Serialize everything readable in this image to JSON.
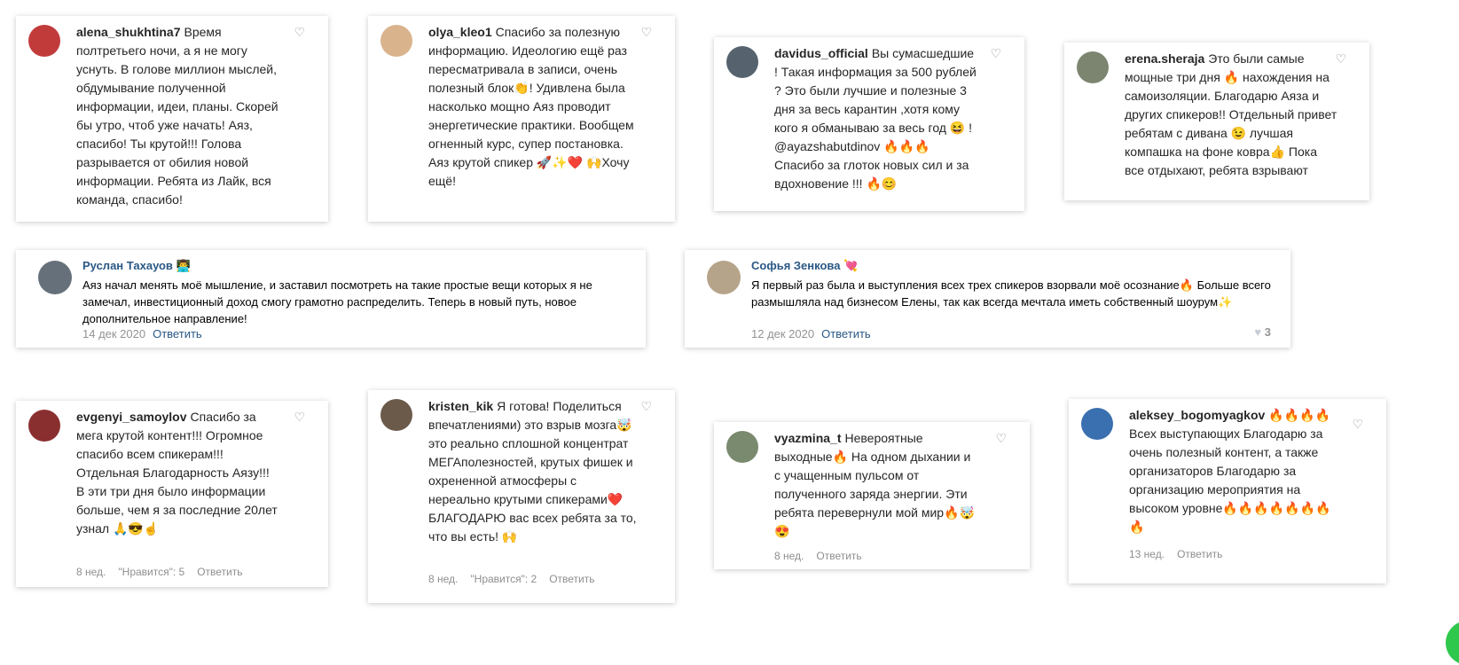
{
  "row1": [
    {
      "username": "alena_shukhtina7",
      "text": "Время полтретьего ночи, а я не могу уснуть. В голове миллион мыслей, обдумывание полученной информации, идеи, планы. Скорей бы утро, чтоб уже начать! Аяз, спасибо! Ты крутой!!! Голова разрывается от обилия новой информации. Ребята из Лайк, вся команда, спасибо!"
    },
    {
      "username": "olya_kleo1",
      "text": "Спасибо за полезную информацию. Идеологию ещё раз пересматривала в записи, очень полезный блок👏! Удивлена была насколько мощно Аяз проводит энергетические практики. Вообщем огненный курс, супер постановка. Аяз крутой спикер 🚀✨❤️ 🙌Хочу ещё!"
    },
    {
      "username": "davidus_official",
      "text": "Вы сумасшедшие ! Такая информация за 500 рублей ? Это были лучшие и полезные 3 дня за весь карантин ,хотя кому кого я обманываю за весь год 😆 ! @ayazshabutdinov 🔥🔥🔥 Спасибо за глоток новых сил и за вдохновение !!! 🔥😊"
    },
    {
      "username": "erena.sheraja",
      "text": "Это были самые мощные три дня 🔥 нахождения на самоизоляции. Благодарю Аяза и других спикеров!! Отдельный привет ребятам с дивана 😉 лучшая компашка на фоне ковра👍 Пока все отдыхают, ребята взрывают"
    }
  ],
  "vk": [
    {
      "name": "Руслан Тахауов 👨‍💻",
      "text": "Аяз начал менять моё мышление, и заставил посмотреть на такие простые вещи которых я не замечал, инвестиционный доход смогу грамотно распределить. Теперь в новый путь, новое дополнительное направление!",
      "date": "14 дек 2020",
      "reply": "Ответить"
    },
    {
      "name": "Софья Зенкова 💘",
      "text": "Я первый раз была и выступления всех трех спикеров взорвали моё осознание🔥 Больше всего размышляла над бизнесом Елены, так как всегда мечтала иметь собственный шоурум✨",
      "date": "12 дек 2020",
      "reply": "Ответить",
      "likes": "3"
    }
  ],
  "row3": [
    {
      "username": "evgenyi_samoylov",
      "text": "Спасибо за мега крутой контент!!! Огромное спасибо всем спикерам!!! Отдельная Благодарность Аязу!!! В эти три дня было информации больше, чем я за последние 20лет узнал 🙏😎☝️",
      "time": "8 нед.",
      "likes": "\"Нравится\": 5",
      "reply": "Ответить"
    },
    {
      "username": "kristen_kik",
      "text": "Я готова! Поделиться впечатлениями) это взрыв мозга🤯 это реально сплошной концентрат МЕГАполезностей, крутых фишек и охрененной атмосферы с нереально крутыми спикерами❤️ БЛАГОДАРЮ вас всех ребята за то, что вы есть! 🙌",
      "time": "8 нед.",
      "likes": "\"Нравится\": 2",
      "reply": "Ответить"
    },
    {
      "username": "vyazmina_t",
      "text": "Невероятные выходные🔥 На одном дыхании и с учащенным пульсом от полученного заряда энергии. Эти ребята перевернули мой мир🔥🤯😍",
      "time": "8 нед.",
      "reply": "Ответить"
    },
    {
      "username": "aleksey_bogomyagkov",
      "text": "🔥🔥🔥🔥 Всех выступающих Благодарю за очень полезный контент, а также организаторов Благодарю за организацию мероприятия на высоком уровне🔥🔥🔥🔥🔥🔥🔥🔥",
      "time": "13 нед.",
      "reply": "Ответить"
    }
  ],
  "icons": {
    "heart": "♡",
    "like": "♥"
  }
}
